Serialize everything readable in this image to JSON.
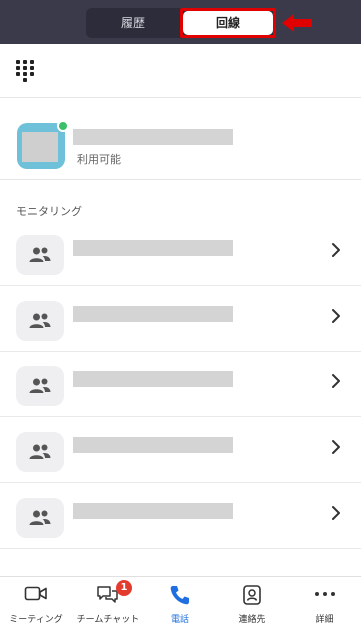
{
  "header": {
    "tabs": [
      {
        "label": "履歴",
        "selected": false
      },
      {
        "label": "回線",
        "selected": true
      }
    ]
  },
  "my_line": {
    "status": "利用可能"
  },
  "monitoring": {
    "title": "モニタリング",
    "rows": [
      {},
      {},
      {},
      {},
      {}
    ]
  },
  "bottom_nav": {
    "items": [
      {
        "label": "ミーティング",
        "icon": "video-camera-icon"
      },
      {
        "label": "チームチャット",
        "icon": "chat-bubbles-icon",
        "badge": "1"
      },
      {
        "label": "電話",
        "icon": "phone-icon",
        "active": true
      },
      {
        "label": "連絡先",
        "icon": "contact-icon"
      },
      {
        "label": "詳細",
        "icon": "more-dots-icon"
      }
    ]
  },
  "colors": {
    "topbar": "#3a3a4a",
    "accent": "#1f6fe0",
    "highlight": "#e00000",
    "presence": "#3cbf6a",
    "badge": "#e33b2e"
  }
}
